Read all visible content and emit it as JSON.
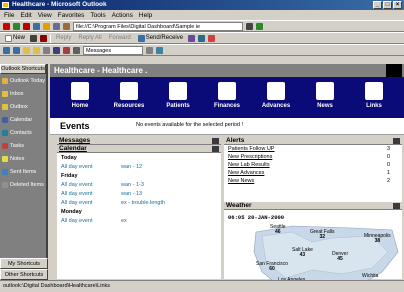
{
  "window": {
    "title": "Healthcare - Microsoft Outlook"
  },
  "menu": [
    "File",
    "Edit",
    "View",
    "Favorites",
    "Tools",
    "Actions",
    "Help"
  ],
  "toolbar": {
    "address": "file://C:\\Program Files\\Digital Dashboard\\Sample ie",
    "new_label": "New",
    "send_receive_label": "Send/Receive",
    "folder_combo": "Messages"
  },
  "shortcuts": {
    "header": "Outlook Shortcuts",
    "items": [
      {
        "label": "Outlook Today",
        "icon": "outlook-today-icon"
      },
      {
        "label": "Inbox",
        "icon": "inbox-icon"
      },
      {
        "label": "Outbox",
        "icon": "outbox-icon"
      },
      {
        "label": "Calendar",
        "icon": "calendar-icon"
      },
      {
        "label": "Contacts",
        "icon": "contacts-icon"
      },
      {
        "label": "Tasks",
        "icon": "tasks-icon"
      },
      {
        "label": "Notes",
        "icon": "notes-icon"
      },
      {
        "label": "Sent Items",
        "icon": "sent-items-icon"
      },
      {
        "label": "Deleted Items",
        "icon": "deleted-items-icon"
      }
    ],
    "my_shortcuts": "My Shortcuts",
    "other_shortcuts": "Other Shortcuts"
  },
  "folder": {
    "title": "Healthcare - Healthcare ."
  },
  "nav": [
    {
      "label": "Home",
      "icon": "home-icon"
    },
    {
      "label": "Resources",
      "icon": "resources-icon"
    },
    {
      "label": "Patients",
      "icon": "patients-icon"
    },
    {
      "label": "Finances",
      "icon": "finances-icon"
    },
    {
      "label": "Advances",
      "icon": "advances-icon"
    },
    {
      "label": "News",
      "icon": "news-icon"
    },
    {
      "label": "Links",
      "icon": "links-icon"
    }
  ],
  "events": {
    "title": "Events",
    "message": "No events available for the selected period !"
  },
  "messages": {
    "title": "Messages"
  },
  "calendar": {
    "title": "Calendar",
    "rows": [
      {
        "type": "day",
        "label": "Today"
      },
      {
        "type": "event",
        "when": "All day event",
        "what": "wan - 12"
      },
      {
        "type": "day",
        "label": "Friday"
      },
      {
        "type": "event",
        "when": "All day event",
        "what": "wan - 1-3"
      },
      {
        "type": "event",
        "when": "All day event",
        "what": "wan - 13"
      },
      {
        "type": "event",
        "when": "All day event",
        "what": "ex - trouble.length"
      },
      {
        "type": "day",
        "label": "Monday"
      },
      {
        "type": "event",
        "when": "All day event",
        "what": "ex"
      }
    ]
  },
  "alerts": {
    "title": "Alerts",
    "rows": [
      {
        "label": "Patients Follow UP",
        "count": "3"
      },
      {
        "label": "New Prescriptions",
        "count": "0"
      },
      {
        "label": "New Lab Results",
        "count": "0"
      },
      {
        "label": "New Advances",
        "count": "1"
      },
      {
        "label": "New News",
        "count": "2"
      }
    ]
  },
  "weather": {
    "title": "Weather",
    "timestamp": "06:05  20-JAN-2000",
    "cities": [
      {
        "name": "Seattle",
        "temp": "46"
      },
      {
        "name": "Great Falls",
        "temp": "32"
      },
      {
        "name": "Minneapolis",
        "temp": "38"
      },
      {
        "name": "Salt Lake",
        "temp": "43"
      },
      {
        "name": "San Francisco",
        "temp": "60"
      },
      {
        "name": "Denver",
        "temp": "45"
      },
      {
        "name": "Los Angeles",
        "temp": "82"
      },
      {
        "name": "Wichita",
        "temp": ""
      }
    ]
  },
  "status": {
    "text": "outlook:\\Digital Dashboard\\Healthcare\\Links"
  }
}
